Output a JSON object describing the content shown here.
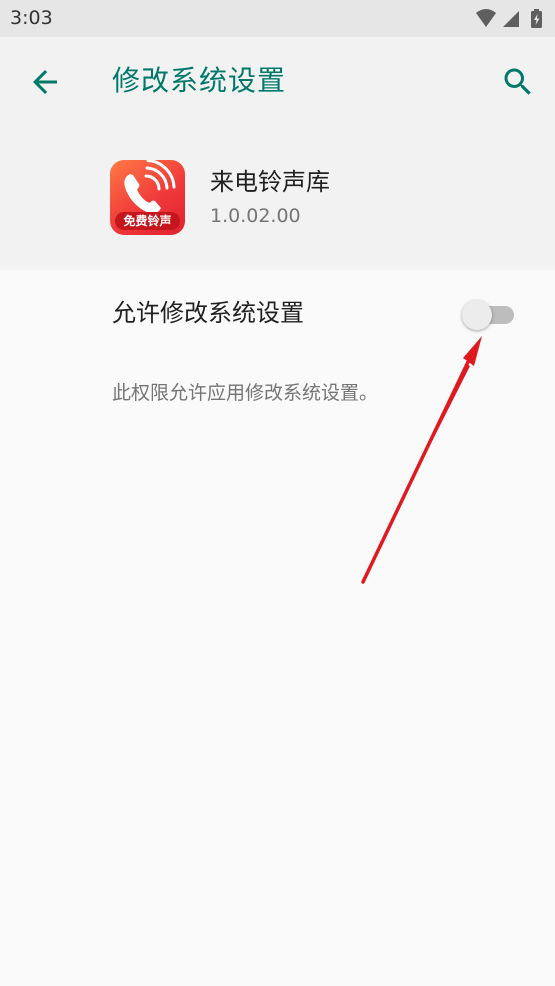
{
  "status_bar": {
    "time": "3:03",
    "icons": [
      "wifi-icon",
      "signal-icon",
      "battery-charging-icon"
    ]
  },
  "app_bar": {
    "title": "修改系统设置",
    "back_icon": "arrow-left-icon",
    "search_icon": "search-icon",
    "accent_color": "#00796b"
  },
  "app_info": {
    "name": "来电铃声库",
    "version": "1.0.02.00",
    "icon_badge": "免费铃声",
    "icon_color": "#f03a3a"
  },
  "setting": {
    "label": "允许修改系统设置",
    "enabled": false,
    "summary": "此权限允许应用修改系统设置。"
  },
  "annotation": {
    "color": "#e0191f"
  }
}
